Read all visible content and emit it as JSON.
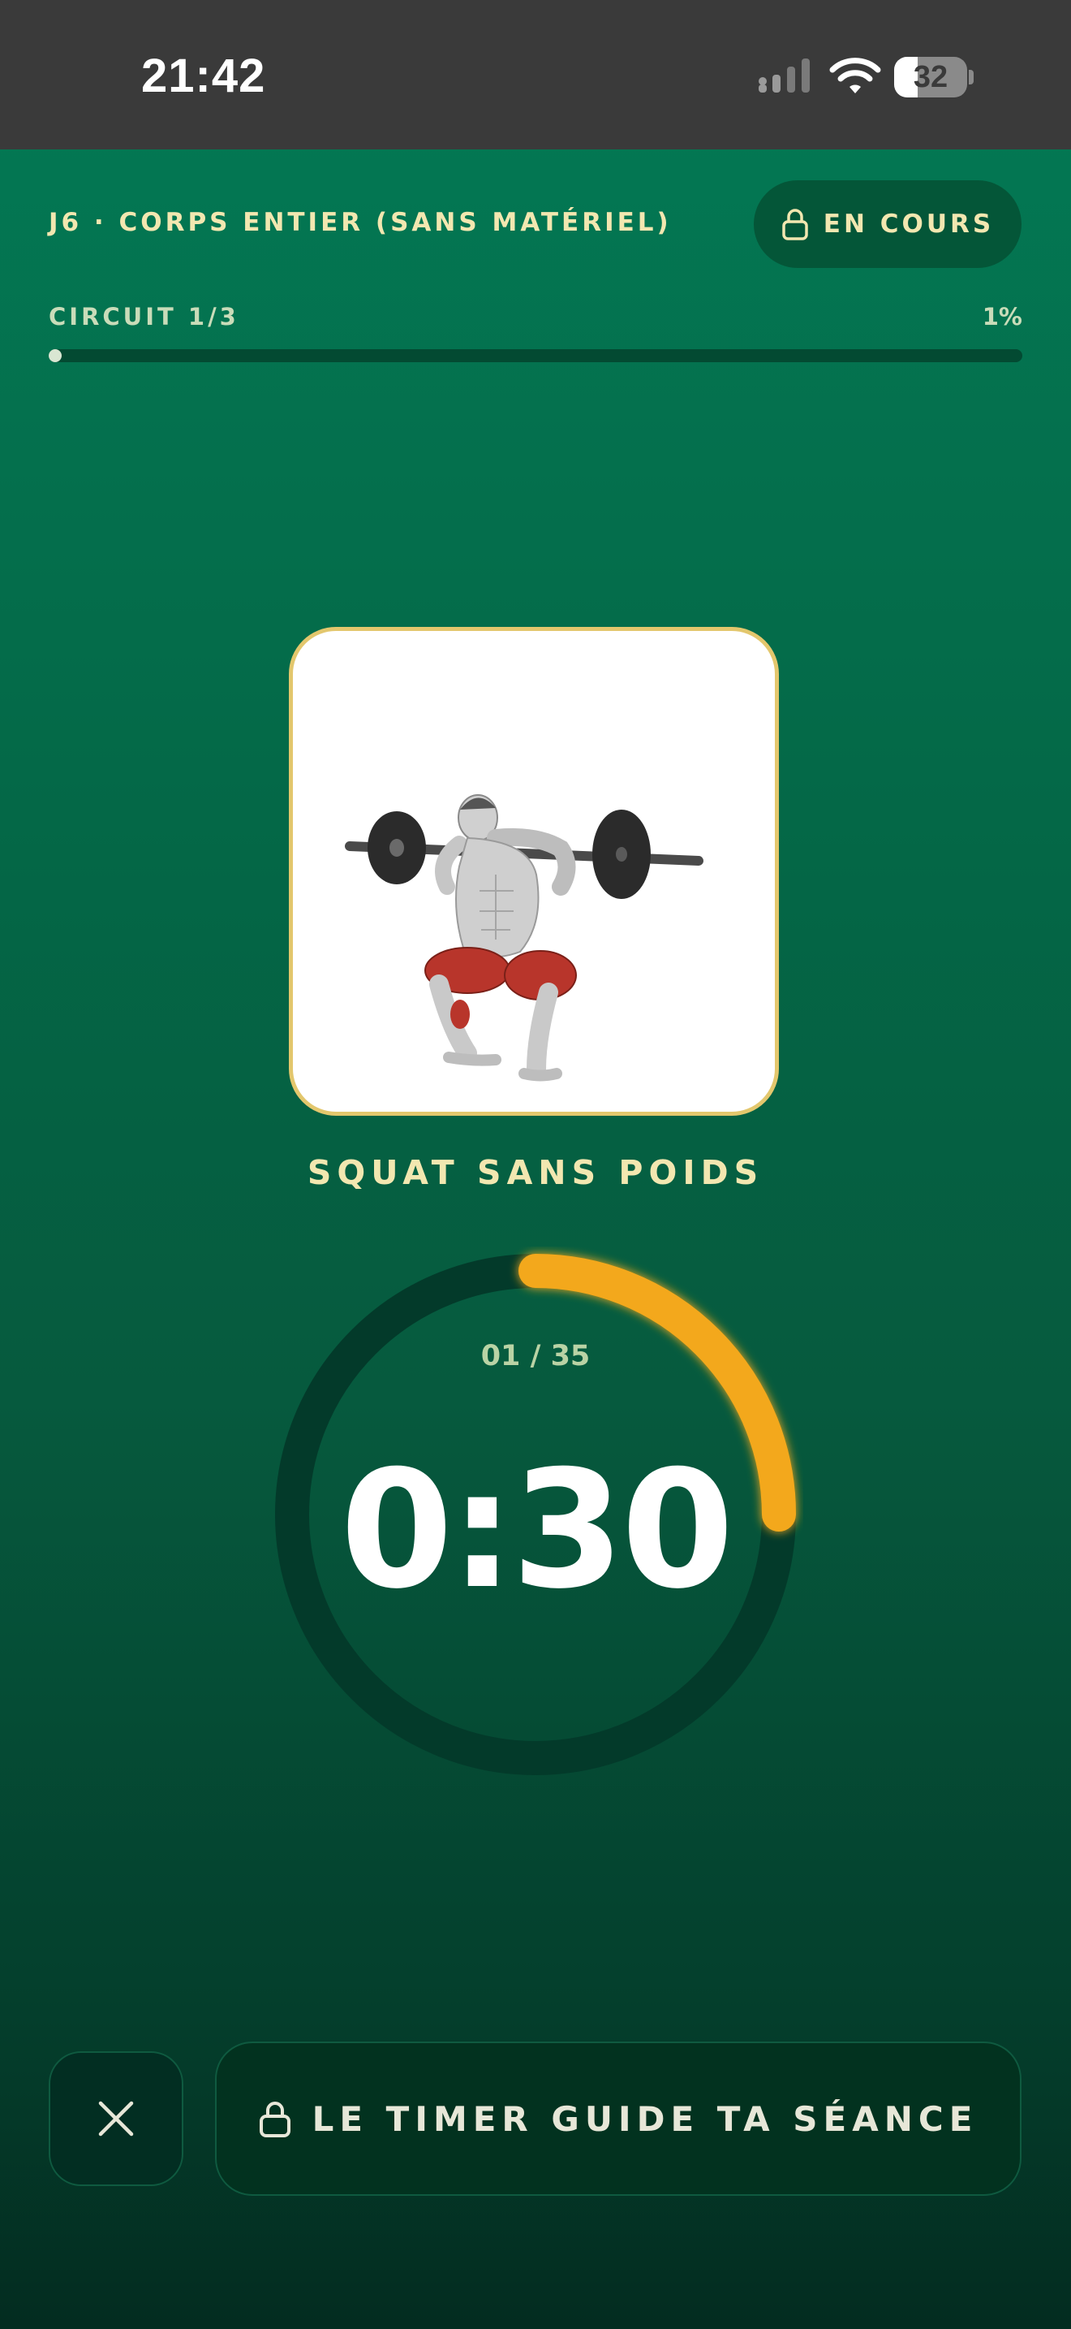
{
  "status_bar": {
    "time": "21:42",
    "battery_level": "32",
    "icons": [
      "signal-icon",
      "wifi-icon",
      "battery-icon"
    ]
  },
  "header": {
    "session_title": "J6 · CORPS ENTIER (SANS MATÉRIEL)",
    "status_label": "EN COURS",
    "status_icon": "lock-icon"
  },
  "progress": {
    "circuit_label": "CIRCUIT 1/3",
    "percent_label": "1%",
    "percent": 1
  },
  "exercise": {
    "name": "SQUAT SANS POIDS",
    "image_icon": "squat-illustration"
  },
  "timer": {
    "rep_counter": "01 / 35",
    "time_left": "0:30",
    "elapsed_fraction": 0.25
  },
  "controls": {
    "close_icon": "close-icon",
    "guide_label": "LE TIMER GUIDE TA SÉANCE",
    "guide_icon": "lock-icon"
  },
  "colors": {
    "accent_gold": "#f2e7b0",
    "timer_arc": "#f3a81f",
    "ring_track": "#033a2a",
    "card_border": "#e3c76d"
  }
}
